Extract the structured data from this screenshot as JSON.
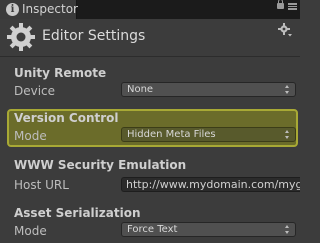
{
  "tab": {
    "label": "Inspector"
  },
  "header": {
    "title": "Editor Settings"
  },
  "sections": {
    "unity_remote": {
      "title": "Unity Remote",
      "device_label": "Device",
      "device_value": "None"
    },
    "version_control": {
      "title": "Version Control",
      "mode_label": "Mode",
      "mode_value": "Hidden Meta Files"
    },
    "www_security": {
      "title": "WWW Security Emulation",
      "host_label": "Host URL",
      "host_value": "http://www.mydomain.com/mygam"
    },
    "asset_serialization": {
      "title": "Asset Serialization",
      "mode_label": "Mode",
      "mode_value": "Force Text"
    }
  },
  "icons": {
    "tab": "info-icon",
    "lock": "lock-icon",
    "menu": "menu-icon",
    "header": "gear-icon",
    "settings": "settings-gear-icon"
  },
  "colors": {
    "highlight_fill": "#6b6c2a",
    "highlight_border": "#a8a935",
    "panel": "#3c3c3c"
  }
}
